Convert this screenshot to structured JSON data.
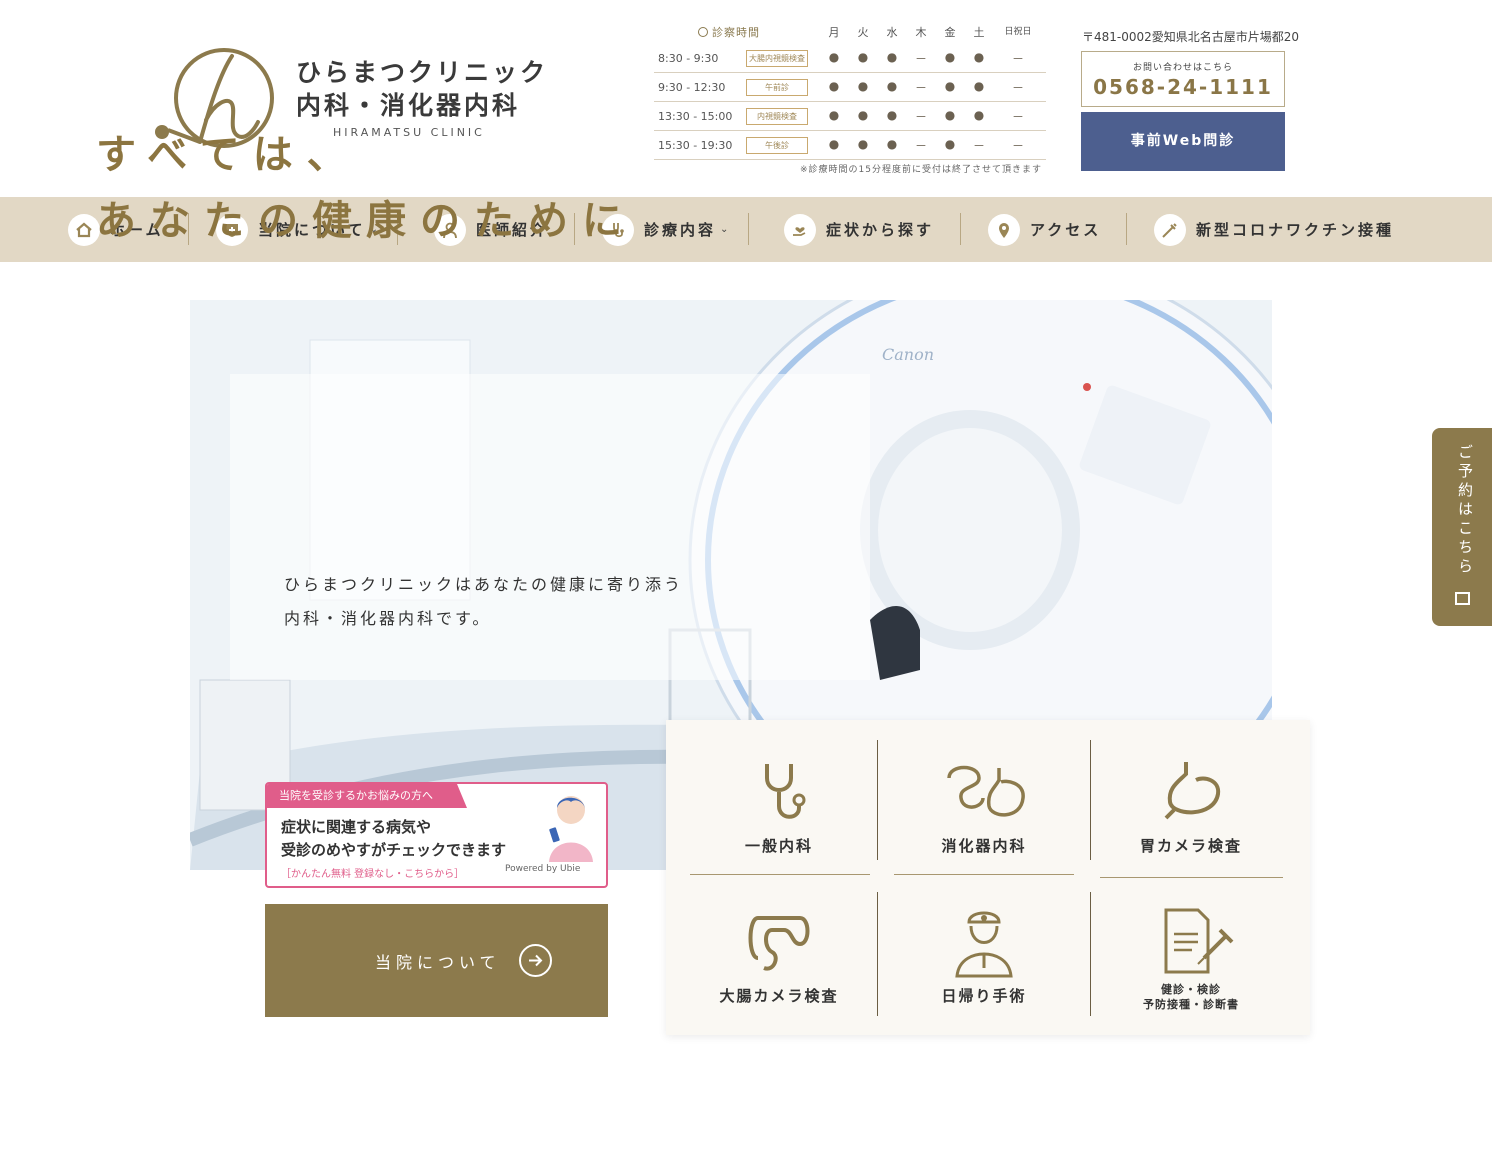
{
  "clinic": {
    "name": "ひらまつクリニック",
    "dept": "内科・消化器内科",
    "name_en": "HIRAMATSU CLINIC"
  },
  "hours": {
    "title": "診察時間",
    "days": [
      "月",
      "火",
      "水",
      "木",
      "金",
      "土",
      "日祝日"
    ],
    "rows": [
      {
        "time": "8:30 - 9:30",
        "tag": "大腸内視鏡検査",
        "marks": [
          "●",
          "●",
          "●",
          "－",
          "●",
          "●",
          "－"
        ]
      },
      {
        "time": "9:30 - 12:30",
        "tag": "午前診",
        "marks": [
          "●",
          "●",
          "●",
          "－",
          "●",
          "●",
          "－"
        ]
      },
      {
        "time": "13:30 - 15:00",
        "tag": "内視鏡検査",
        "marks": [
          "●",
          "●",
          "●",
          "－",
          "●",
          "●",
          "－"
        ]
      },
      {
        "time": "15:30 - 19:30",
        "tag": "午後診",
        "marks": [
          "●",
          "●",
          "●",
          "－",
          "●",
          "－",
          "－"
        ]
      }
    ],
    "note": "※診療時間の15分程度前に受付は終了させて頂きます"
  },
  "contact": {
    "address": "〒481-0002愛知県北名古屋市片場都20",
    "label": "お問い合わせはこちら",
    "tel": "0568-24-1111",
    "web_button": "事前Web問診"
  },
  "nav": [
    {
      "label": "ホーム",
      "icon": "home-icon"
    },
    {
      "label": "当院について",
      "icon": "shield-plus-icon",
      "dropdown": true
    },
    {
      "label": "医師紹介",
      "icon": "doctor-icon"
    },
    {
      "label": "診療内容",
      "icon": "stethoscope-icon",
      "dropdown": true
    },
    {
      "label": "症状から探す",
      "icon": "hand-heart-icon"
    },
    {
      "label": "アクセス",
      "icon": "map-pin-icon"
    },
    {
      "label": "新型コロナワクチン接種",
      "icon": "syringe-icon"
    }
  ],
  "hero": {
    "line1": "すべては、",
    "line2": "あなたの健康のために",
    "sub1": "ひらまつクリニックはあなたの健康に寄り添う",
    "sub2": "内科・消化器内科です。",
    "scanner_brand": "Canon"
  },
  "side_tab": {
    "label": "ご予約はこちら"
  },
  "ubie": {
    "tag": "当院を受診するかお悩みの方へ",
    "line1": "症状に関連する病気や",
    "line2": "受診のめやすがチェックできます",
    "note": "［かんたん無料 登録なし・こちらから］",
    "powered": "Powered by Ubie"
  },
  "about_button": {
    "label": "当院について"
  },
  "services": [
    {
      "label": "一般内科",
      "icon": "stethoscope-icon"
    },
    {
      "label": "消化器内科",
      "icon": "intestine-stomach-icon"
    },
    {
      "label": "胃カメラ検査",
      "icon": "stomach-icon"
    },
    {
      "label": "大腸カメラ検査",
      "icon": "colon-icon"
    },
    {
      "label": "日帰り手術",
      "icon": "surgeon-icon"
    },
    {
      "label1": "健診・検診",
      "label2": "予防接種・診断書",
      "icon": "document-syringe-icon"
    }
  ],
  "colors": {
    "brand_gold": "#8c7a4c",
    "nav_bg": "#e2d8c5",
    "web_button": "#4d5f8f",
    "ubie_pink": "#e05d8a"
  }
}
